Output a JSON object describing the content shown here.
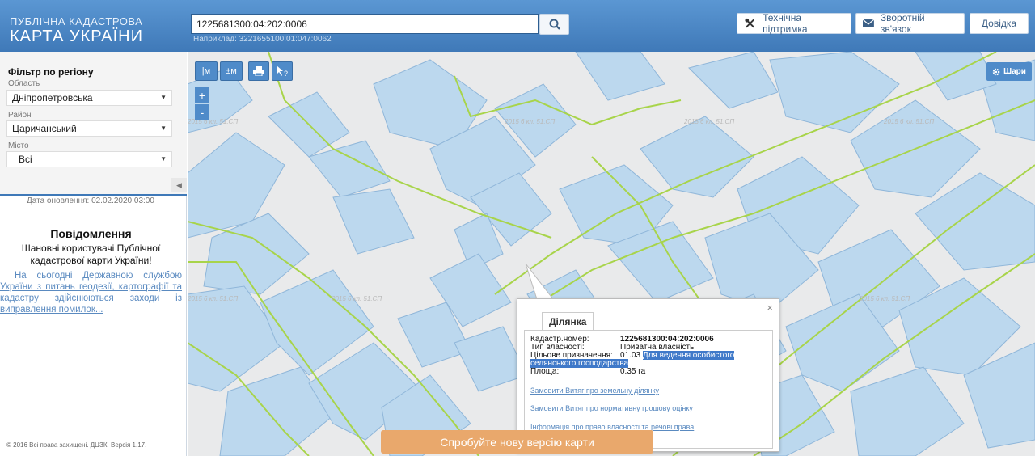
{
  "header": {
    "logo_top": "ПУБЛІЧНА КАДАСТРОВА",
    "logo_main": "КАРТА УКРАЇНИ",
    "search_value": "1225681300:04:202:0006",
    "search_hint": "Наприклад: 3221655100:01:047:0062",
    "support_label": "Технічна підтримка",
    "feedback_label": "Зворотній зв'язок",
    "help_label": "Довідка"
  },
  "filter": {
    "title": "Фільтр по регіону",
    "oblast_label": "Область",
    "oblast_value": "Дніпропетровська",
    "raion_label": "Район",
    "raion_value": "Царичанський",
    "misto_label": "Місто",
    "misto_value": "Всі"
  },
  "sidebar": {
    "update_date": "Дата оновлення: 02.02.2020 03:00",
    "notice_title": "Повідомлення",
    "notice_subtitle": "Шановні користувачі Публічної кадастрової карти України!",
    "notice_body_lead": "На сьогодні Державною службою",
    "notice_body_link": "України з питань геодезії, картографії та кадастру здійснюються заходи із виправлення помилок...",
    "copyright": "© 2016 Всі права захищені. ДЦЗК. Версія 1.17."
  },
  "map": {
    "tools": [
      "|м",
      "±м",
      "print",
      "info"
    ],
    "layers_label": "Шари",
    "zoom_in": "+",
    "zoom_out": "-",
    "watermark_text": "2015 6 кл. 51.СП"
  },
  "popup": {
    "tab": "Ділянка",
    "rows": [
      {
        "key": "Кадастр.номер:",
        "value": "1225681300:04:202:0006"
      },
      {
        "key": "Тип власності:",
        "value": "Приватна власність"
      },
      {
        "key": "Цільове призначення:",
        "value": "01.03",
        "value_highlight": "Для ведення особистого"
      },
      {
        "key": "",
        "value": "селянського господарства"
      },
      {
        "key": "Площа:",
        "value": "0.35 га"
      }
    ],
    "links": [
      "Замовити Витяг про земельну ділянку",
      "Замовити Витяг про нормативну грошову оцінку",
      "Інформація про право власності та речові права"
    ]
  },
  "new_version_label": "Спробуйте нову версію карти",
  "colors": {
    "header_bg": "#4f8bc9",
    "parcel_fill": "#bcd8ee",
    "parcel_stroke": "#8fb6d9",
    "road_green": "#a8d44a",
    "new_version_bg": "#e9a86c"
  }
}
